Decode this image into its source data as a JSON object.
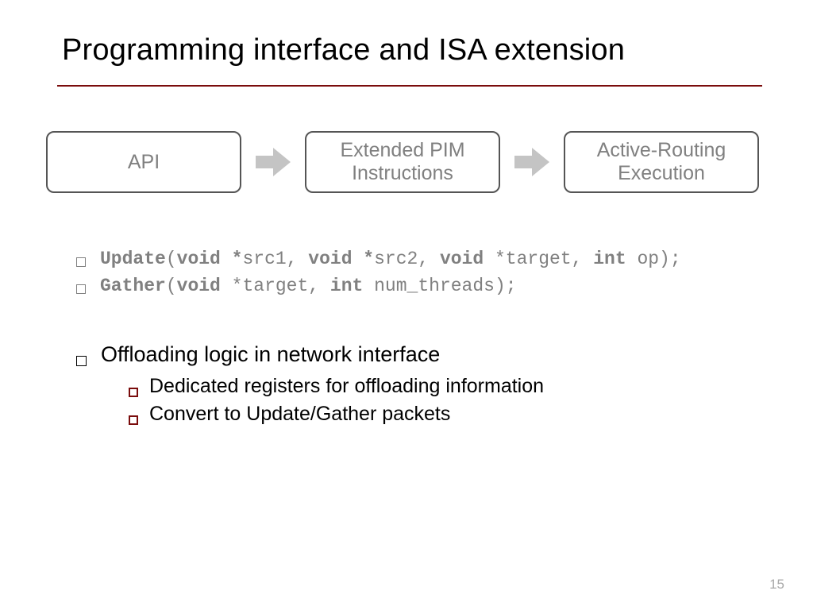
{
  "title": "Programming interface and ISA extension",
  "flow": {
    "box1": "API",
    "box2": "Extended PIM Instructions",
    "box3": "Active-Routing Execution"
  },
  "api_calls": {
    "update": {
      "name": "Update",
      "open": "(",
      "p1_type": "void *",
      "p1_name": "src1",
      "sep1": ", ",
      "p2_type": "void *",
      "p2_name": "src2",
      "sep2": ", ",
      "p3_type": "void ",
      "p3_star": "*",
      "p3_name": "target",
      "sep3": ", ",
      "p4_type": "int ",
      "p4_name": "op",
      "close": ");"
    },
    "gather": {
      "name": "Gather",
      "open": "(",
      "p1_type": "void ",
      "p1_star": "*",
      "p1_name": "target",
      "sep1": ", ",
      "p2_type": "int ",
      "p2_name": "num_threads",
      "close": ");"
    }
  },
  "body": {
    "item1": "Offloading logic in network interface",
    "sub1": "Dedicated registers for offloading information",
    "sub2": "Convert to Update/Gather packets"
  },
  "page_number": "15"
}
